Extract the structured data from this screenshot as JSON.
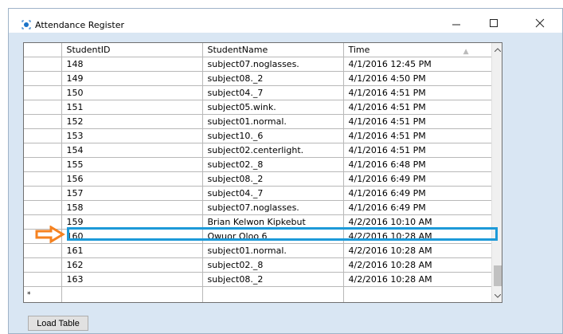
{
  "window": {
    "title": "Attendance Register",
    "minimize_glyph": "—",
    "maximize_glyph": "☐",
    "close_glyph": "✕"
  },
  "grid": {
    "columns": [
      "StudentID",
      "StudentName",
      "Time"
    ],
    "rows": [
      {
        "id": "148",
        "name": "subject07.noglasses.",
        "time": "4/1/2016 12:45 PM"
      },
      {
        "id": "149",
        "name": "subject08._2",
        "time": "4/1/2016 4:50 PM"
      },
      {
        "id": "150",
        "name": "subject04._7",
        "time": "4/1/2016 4:51 PM"
      },
      {
        "id": "151",
        "name": "subject05.wink.",
        "time": "4/1/2016 4:51 PM"
      },
      {
        "id": "152",
        "name": "subject01.normal.",
        "time": "4/1/2016 4:51 PM"
      },
      {
        "id": "153",
        "name": "subject10._6",
        "time": "4/1/2016 4:51 PM"
      },
      {
        "id": "154",
        "name": "subject02.centerlight.",
        "time": "4/1/2016 4:51 PM"
      },
      {
        "id": "155",
        "name": "subject02._8",
        "time": "4/1/2016 6:48 PM"
      },
      {
        "id": "156",
        "name": "subject08._2",
        "time": "4/1/2016 6:49 PM"
      },
      {
        "id": "157",
        "name": "subject04._7",
        "time": "4/1/2016 6:49 PM"
      },
      {
        "id": "158",
        "name": "subject07.noglasses.",
        "time": "4/1/2016 6:49 PM"
      },
      {
        "id": "159",
        "name": "Brian Kelwon Kipkebut",
        "time": "4/2/2016 10:10 AM"
      },
      {
        "id": "160",
        "name": "Owuor Oloo 6",
        "time": "4/2/2016 10:28 AM"
      },
      {
        "id": "161",
        "name": "subject01.normal.",
        "time": "4/2/2016 10:28 AM"
      },
      {
        "id": "162",
        "name": "subject02._8",
        "time": "4/2/2016 10:28 AM"
      },
      {
        "id": "163",
        "name": "subject08._2",
        "time": "4/2/2016 10:28 AM"
      }
    ],
    "new_row_marker": "*",
    "highlighted_row_id": "159"
  },
  "buttons": {
    "load_table": "Load Table"
  },
  "colors": {
    "highlight": "#1d9ad8",
    "arrow": "#f58220",
    "window_bg": "#d9e6f3"
  },
  "icons": {
    "app": "app-dot-icon",
    "pointer": "orange-arrow-icon",
    "sort": "sort-up-icon",
    "scroll_up": "scroll-up-icon",
    "scroll_down": "scroll-down-icon"
  }
}
